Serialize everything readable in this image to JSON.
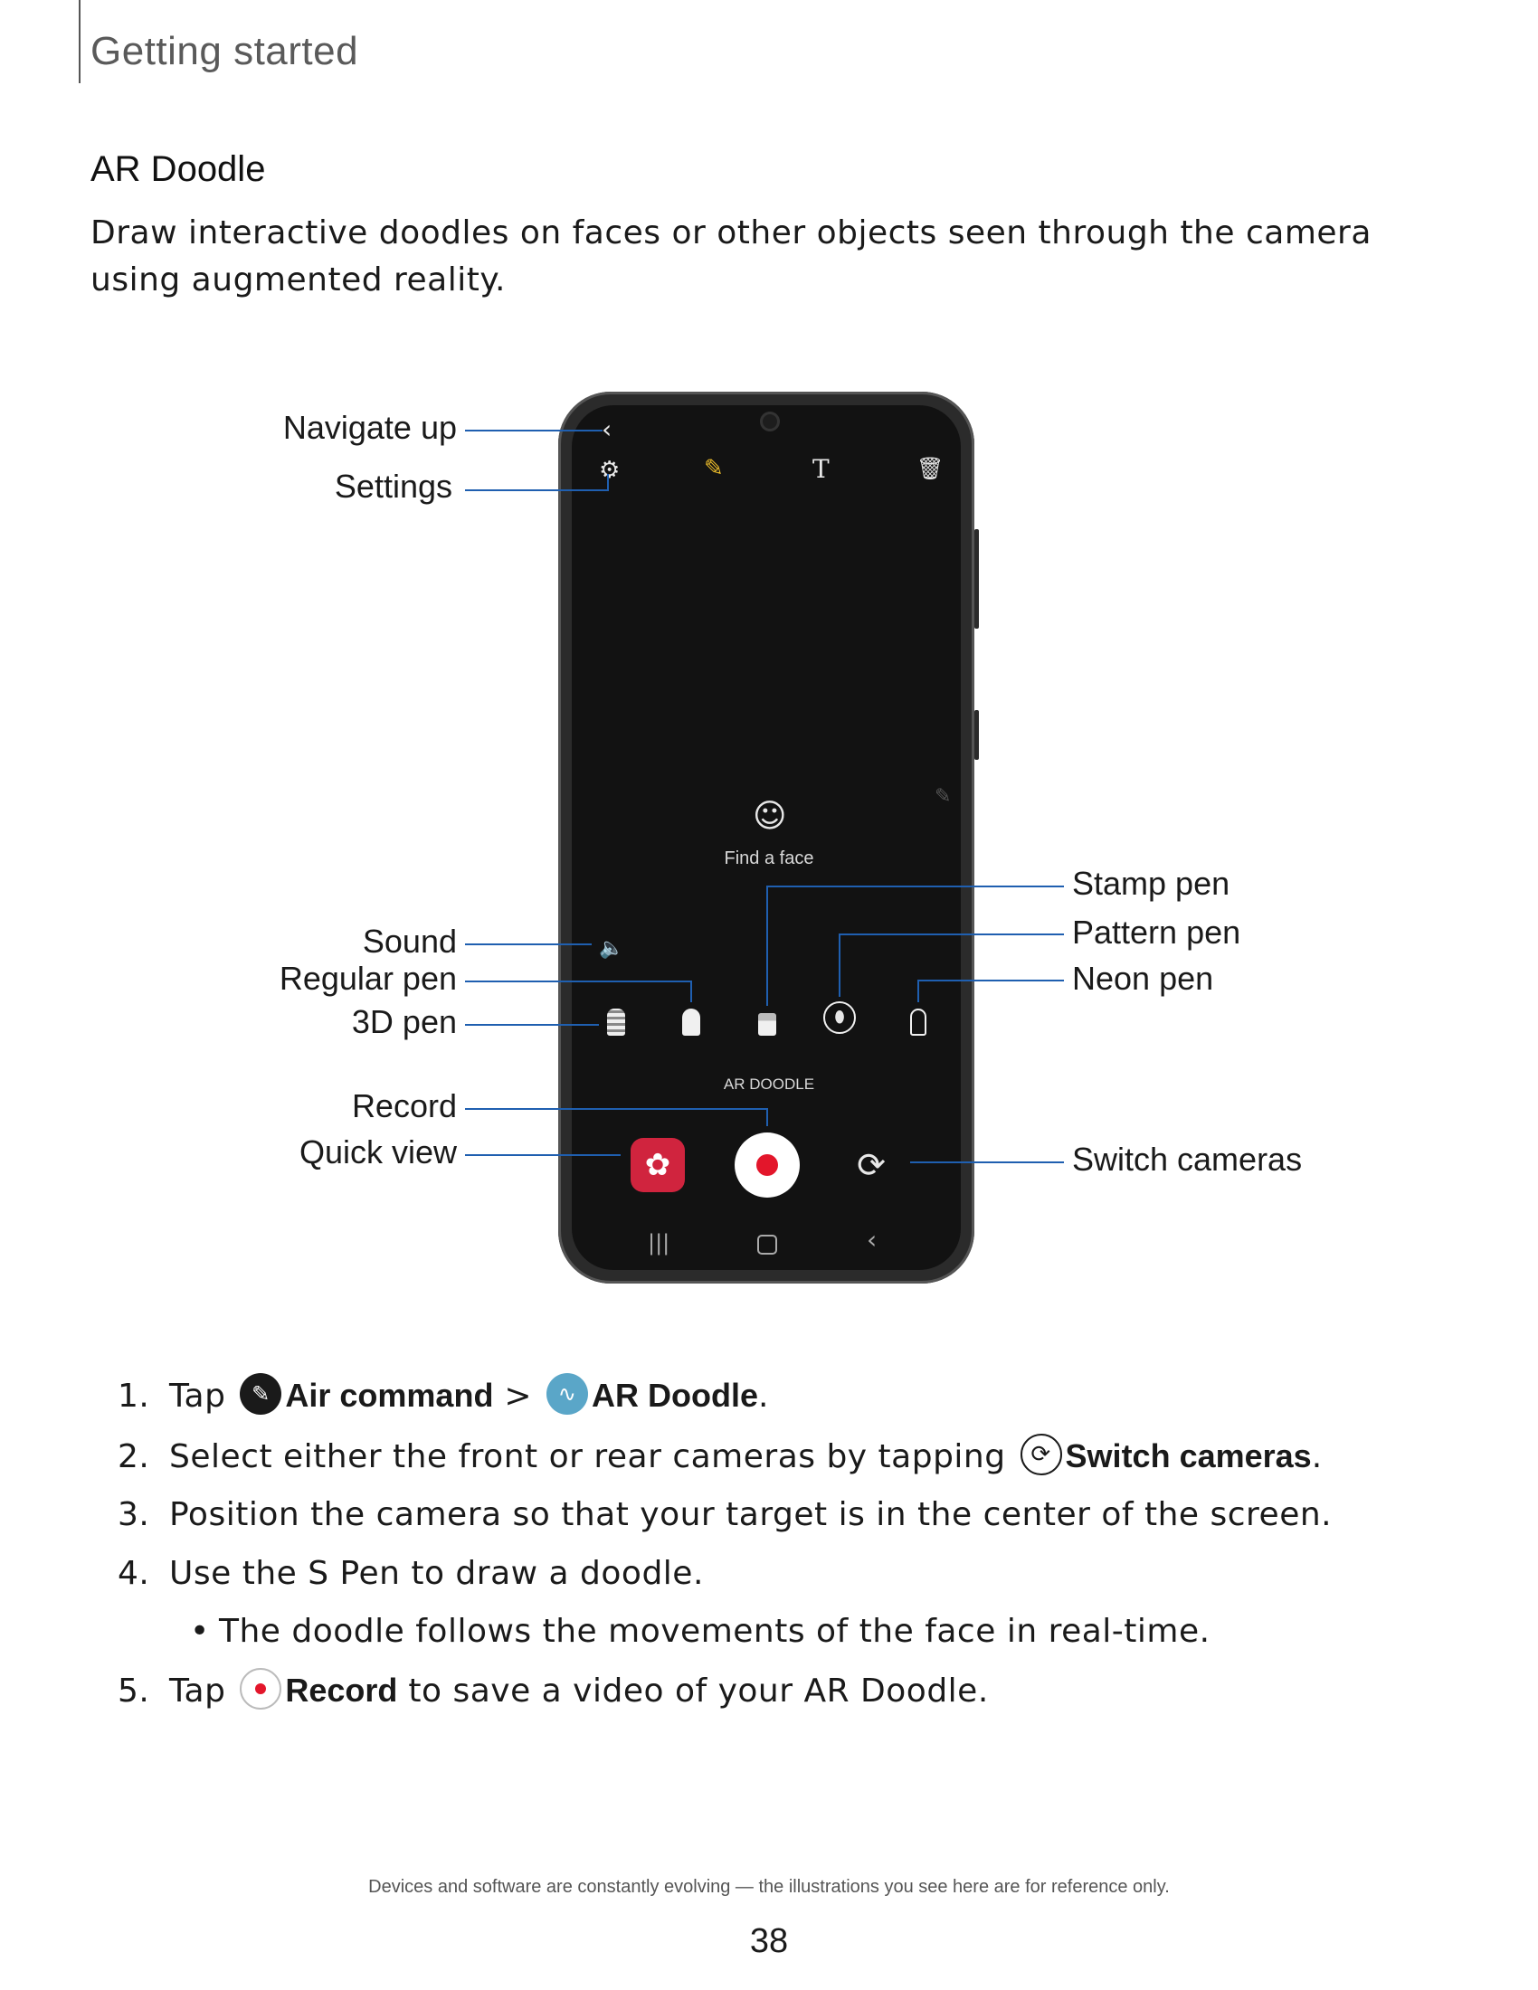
{
  "header": {
    "section": "Getting started"
  },
  "page": {
    "title": "AR Doodle",
    "intro": "Draw interactive doodles on faces or other objects seen through the camera using augmented reality."
  },
  "screen": {
    "find_face": "Find a face",
    "mode_label": "AR DOODLE",
    "icons": [
      "back-icon",
      "settings-icon",
      "pencil-icon",
      "text-icon",
      "trash-icon",
      "smiley-icon",
      "sound-icon",
      "3d-pen-icon",
      "regular-pen-icon",
      "stamp-pen-icon",
      "pattern-pen-icon",
      "neon-pen-icon",
      "quick-view-icon",
      "record-icon",
      "switch-cameras-icon",
      "recents-icon",
      "home-icon",
      "back-nav-icon"
    ],
    "accent_yellow": "#e8b92a",
    "record_red": "#e3162b",
    "quick_view_color": "#d0243e"
  },
  "callouts": {
    "navigate_up": "Navigate up",
    "settings": "Settings",
    "sound": "Sound",
    "regular_pen": "Regular pen",
    "pen_3d": "3D pen",
    "record": "Record",
    "quick_view": "Quick view",
    "stamp_pen": "Stamp pen",
    "pattern_pen": "Pattern pen",
    "neon_pen": "Neon pen",
    "switch_cameras": "Switch cameras",
    "line_color": "#1f5fb0"
  },
  "steps": {
    "s1": {
      "num": "1.",
      "pre": "Tap ",
      "air_command": "Air command",
      "sep": " > ",
      "ar_doodle": "AR Doodle",
      "post": "."
    },
    "s2": {
      "num": "2.",
      "pre": "Select either the front or rear cameras by tapping ",
      "switch_cameras": "Switch cameras",
      "post": "."
    },
    "s3": {
      "num": "3.",
      "text": "Position the camera so that your target is in the center of the screen."
    },
    "s4": {
      "num": "4.",
      "text": "Use the S Pen to draw a doodle."
    },
    "s4_bullet": "The doodle follows the movements of the face in real-time.",
    "s5": {
      "num": "5.",
      "pre": "Tap ",
      "record": "Record",
      "post": " to save a video of your AR Doodle."
    }
  },
  "footer": {
    "note": "Devices and software are constantly evolving — the illustrations you see here are for reference only.",
    "page_number": "38"
  }
}
